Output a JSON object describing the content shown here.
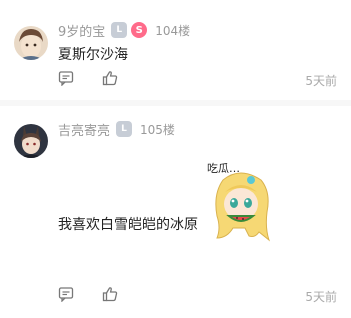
{
  "comments": [
    {
      "username": "9岁的宝",
      "level_badge": "L",
      "special_badge": "S",
      "floor": "104楼",
      "text": "夏斯尔沙海",
      "time": "5天前"
    },
    {
      "username": "吉亮寄亮",
      "level_badge": "L",
      "floor": "105楼",
      "text": "我喜欢白雪皑皑的冰原",
      "time": "5天前",
      "sticker_text": "吃瓜…"
    }
  ],
  "colors": {
    "muted_text": "#999999",
    "badge_gray": "#c7cdd6",
    "badge_pink": "#ff6b8a"
  },
  "icons": [
    "comment-icon",
    "thumbs-up-icon"
  ]
}
